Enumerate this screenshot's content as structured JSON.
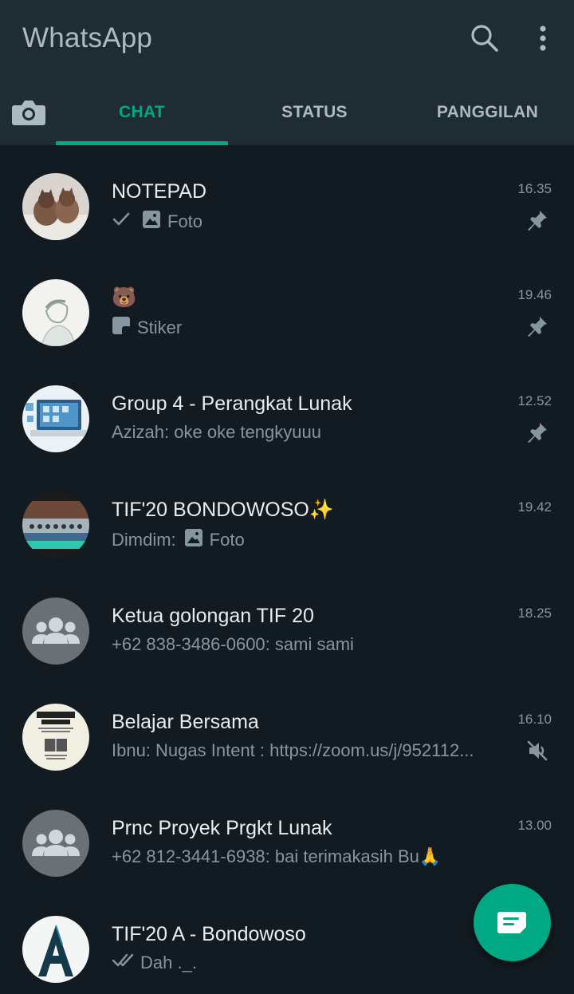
{
  "app": {
    "title": "WhatsApp"
  },
  "icons": {
    "search": "search-icon",
    "menu": "more-vert-icon",
    "camera": "camera-icon",
    "new_chat": "new-chat-icon"
  },
  "colors": {
    "accent": "#00a884",
    "header": "#1f2c34",
    "background": "#121b22",
    "secondary_text": "#8696a0"
  },
  "tabs": [
    {
      "label": "CHAT",
      "active": true
    },
    {
      "label": "STATUS",
      "active": false
    },
    {
      "label": "PANGGILAN",
      "active": false
    }
  ],
  "chats": [
    {
      "name": "NOTEPAD",
      "preview": "Foto",
      "time": "16.35",
      "indicator": "pin-icon",
      "prefix_icon": "single-check-icon",
      "media_icon": "photo-icon"
    },
    {
      "name": "🐻",
      "preview": "Stiker",
      "time": "19.46",
      "indicator": "pin-icon",
      "media_icon": "sticker-icon"
    },
    {
      "name": "Group 4 - Perangkat Lunak",
      "preview": "Azizah: oke oke tengkyuuu",
      "time": "12.52",
      "indicator": "pin-icon"
    },
    {
      "name": "TIF'20 BONDOWOSO✨",
      "sender": "Dimdim:",
      "preview": "Foto",
      "time": "19.42",
      "media_icon": "photo-icon"
    },
    {
      "name": "Ketua golongan TIF 20",
      "preview": "+62 838-3486-0600: sami sami",
      "time": "18.25"
    },
    {
      "name": "Belajar Bersama",
      "preview": "Ibnu: Nugas Intent : https://zoom.us/j/952112...",
      "time": "16.10",
      "indicator": "muted-icon"
    },
    {
      "name": "Prnc Proyek Prgkt Lunak",
      "preview": "+62 812-3441-6938: bai terimakasih Bu🙏",
      "time": "13.00"
    },
    {
      "name": "TIF'20 A - Bondowoso",
      "preview": "Dah ._.",
      "prefix_icon": "double-check-icon"
    }
  ]
}
